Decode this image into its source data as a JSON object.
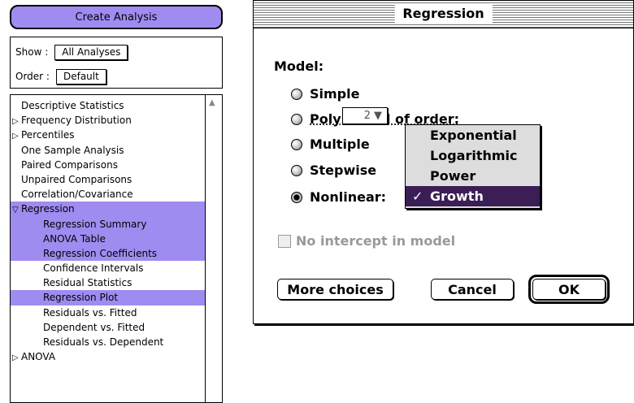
{
  "palette": {
    "create_button": "Create Analysis",
    "show_label": "Show :",
    "show_value": "All Analyses",
    "order_label": "Order :",
    "order_value": "Default",
    "items": [
      {
        "label": "Descriptive Statistics",
        "indent": 0,
        "tri": "",
        "hl": false
      },
      {
        "label": "Frequency Distribution",
        "indent": 0,
        "tri": "▷",
        "hl": false
      },
      {
        "label": "Percentiles",
        "indent": 0,
        "tri": "▷",
        "hl": false
      },
      {
        "label": "One Sample Analysis",
        "indent": 0,
        "tri": "",
        "hl": false
      },
      {
        "label": "Paired Comparisons",
        "indent": 0,
        "tri": "",
        "hl": false
      },
      {
        "label": "Unpaired Comparisons",
        "indent": 0,
        "tri": "",
        "hl": false
      },
      {
        "label": "Correlation/Covariance",
        "indent": 0,
        "tri": "",
        "hl": false
      },
      {
        "label": "Regression",
        "indent": 0,
        "tri": "▽",
        "hl": true
      },
      {
        "label": "Regression Summary",
        "indent": 1,
        "tri": "",
        "hl": true
      },
      {
        "label": "ANOVA Table",
        "indent": 1,
        "tri": "",
        "hl": true
      },
      {
        "label": "Regression Coefficients",
        "indent": 1,
        "tri": "",
        "hl": true
      },
      {
        "label": "Confidence Intervals",
        "indent": 1,
        "tri": "",
        "hl": false
      },
      {
        "label": "Residual Statistics",
        "indent": 1,
        "tri": "",
        "hl": false
      },
      {
        "label": "Regression Plot",
        "indent": 1,
        "tri": "",
        "hl": true
      },
      {
        "label": "Residuals vs. Fitted",
        "indent": 1,
        "tri": "",
        "hl": false
      },
      {
        "label": "Dependent vs. Fitted",
        "indent": 1,
        "tri": "",
        "hl": false
      },
      {
        "label": "Residuals vs. Dependent",
        "indent": 1,
        "tri": "",
        "hl": false
      },
      {
        "label": "ANOVA",
        "indent": 0,
        "tri": "▷",
        "hl": false
      }
    ]
  },
  "dialog": {
    "title": "Regression",
    "model_label": "Model:",
    "radios": [
      {
        "label": "Simple",
        "selected": false
      },
      {
        "label": "Polynomial of order:",
        "selected": false
      },
      {
        "label": "Multiple",
        "selected": false
      },
      {
        "label": "Stepwise",
        "selected": false
      },
      {
        "label": "Nonlinear:",
        "selected": true
      }
    ],
    "order_value": "2",
    "nonlinear_menu": [
      {
        "label": "Exponential",
        "selected": false
      },
      {
        "label": "Logarithmic",
        "selected": false
      },
      {
        "label": "Power",
        "selected": false
      },
      {
        "label": "Growth",
        "selected": true
      }
    ],
    "checkmark": "✓",
    "no_intercept_label": "No intercept in model",
    "more_choices_label": "More choices",
    "cancel_label": "Cancel",
    "ok_label": "OK"
  }
}
